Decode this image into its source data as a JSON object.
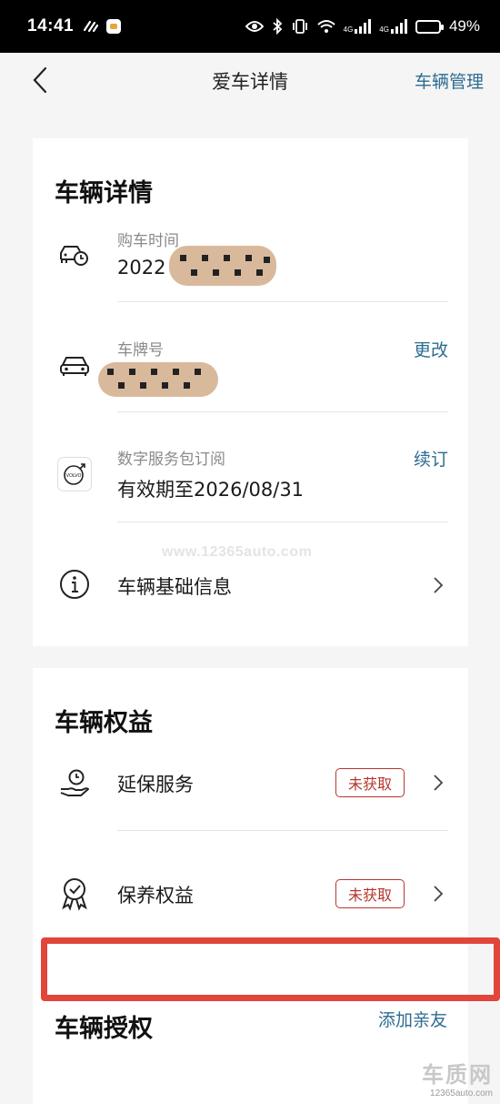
{
  "status_bar": {
    "time": "14:41",
    "net_tag_1": "4G",
    "net_tag_2": "4G",
    "battery_percent": "49%",
    "battery_level": 0.49
  },
  "nav": {
    "title": "爱车详情",
    "action": "车辆管理"
  },
  "vehicle_details": {
    "title": "车辆详情",
    "purchase_time": {
      "label": "购车时间",
      "value": "2022"
    },
    "plate": {
      "label": "车牌号",
      "action": "更改"
    },
    "subscription": {
      "label": "数字服务包订阅",
      "value": "有效期至2026/08/31",
      "action": "续订",
      "logo_text": "VOLVO"
    },
    "basic_info": {
      "label": "车辆基础信息"
    }
  },
  "watermark": "www.12365auto.com",
  "vehicle_benefits": {
    "title": "车辆权益",
    "items": [
      {
        "label": "延保服务",
        "badge": "未获取"
      },
      {
        "label": "保养权益",
        "badge": "未获取"
      }
    ]
  },
  "authorization": {
    "title": "车辆授权",
    "action": "添加亲友"
  },
  "corner_logo": {
    "brand": "车质网",
    "url": "12365auto.com"
  },
  "colors": {
    "accent_blue": "#2d6c91",
    "badge_red": "#b5372f",
    "highlight_red": "#e2453a",
    "background": "#f5f5f5"
  }
}
